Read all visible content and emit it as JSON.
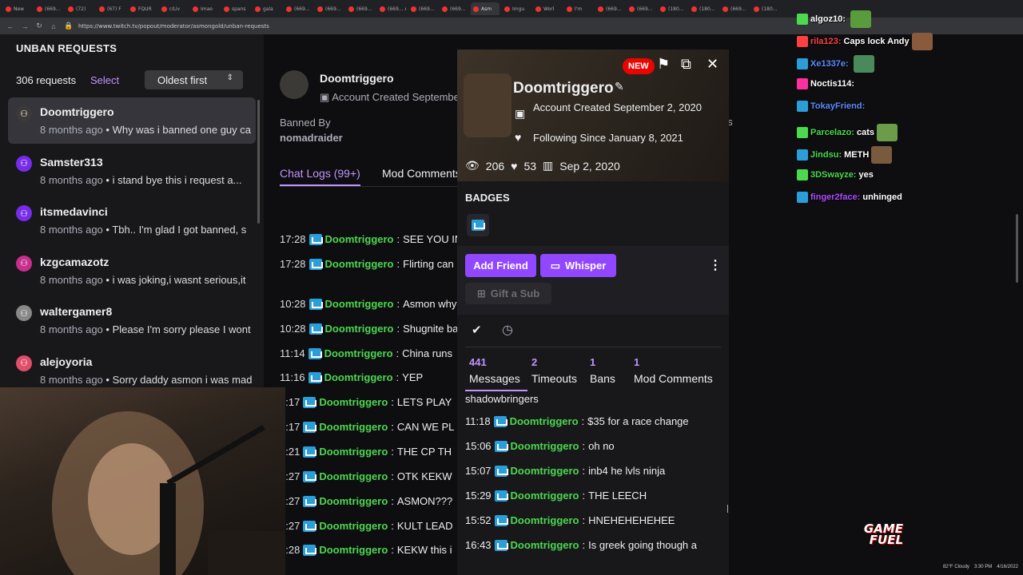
{
  "browser": {
    "tabs": [
      {
        "label": "New"
      },
      {
        "label": "(669..."
      },
      {
        "label": "(72)"
      },
      {
        "label": "(67) F"
      },
      {
        "label": "FQUR"
      },
      {
        "label": "r/Liv"
      },
      {
        "label": "Imao"
      },
      {
        "label": "spans"
      },
      {
        "label": "gala"
      },
      {
        "label": "(669..."
      },
      {
        "label": "(669..."
      },
      {
        "label": "(669..."
      },
      {
        "label": "(669... AUTOM"
      },
      {
        "label": "(669..."
      },
      {
        "label": "(669..."
      },
      {
        "label": "Asm",
        "active": true
      },
      {
        "label": "Imgu"
      },
      {
        "label": "Worl"
      },
      {
        "label": "I'm"
      },
      {
        "label": "(669..."
      },
      {
        "label": "(669..."
      },
      {
        "label": "(180..."
      },
      {
        "label": "(180..."
      },
      {
        "label": "(669..."
      },
      {
        "label": "(180..."
      }
    ],
    "url": "https://www.twitch.tv/popout/moderator/asmongold/unban-requests"
  },
  "unban": {
    "title": "UNBAN REQUESTS",
    "count_label": "306 requests",
    "select_label": "Select",
    "sort_value": "Oldest first",
    "requests": [
      {
        "name": "Doomtriggero",
        "time": "8 months ago",
        "msg": "• Why was i banned one guy ca",
        "selected": true
      },
      {
        "name": "Samster313",
        "time": "8 months ago",
        "msg": "• i stand bye this i request a..."
      },
      {
        "name": "itsmedavinci",
        "time": "8 months ago",
        "msg": "• Tbh.. I'm glad I got banned, s"
      },
      {
        "name": "kzgcamazotz",
        "time": "8 months ago",
        "msg": "• i was joking,i wasnt serious,it"
      },
      {
        "name": "waltergamer8",
        "time": "8 months ago",
        "msg": "• Please I'm sorry please I wont"
      },
      {
        "name": "alejoyoria",
        "time": "8 months ago",
        "msg": "• Sorry daddy asmon i was mad"
      }
    ]
  },
  "detail": {
    "name": "Doomtriggero",
    "account_created": "Account Created September",
    "banned_by_label": "Banned By",
    "banned_by": "nomadraider",
    "tab_chat": "Chat Logs (99+)",
    "tab_mod": "Mod Comments",
    "right_fragment": "ns",
    "logs": [
      {
        "time": "17:28",
        "user": "Doomtriggero",
        "msg": "SEE YOU IN"
      },
      {
        "time": "17:28",
        "user": "Doomtriggero",
        "msg": "Flirting can"
      },
      {
        "time": "10:28",
        "user": "Doomtriggero",
        "msg": "Asmon why"
      },
      {
        "time": "10:28",
        "user": "Doomtriggero",
        "msg": "Shugnite ba"
      },
      {
        "time": "11:14",
        "user": "Doomtriggero",
        "msg": "China runs"
      },
      {
        "time": "11:16",
        "user": "Doomtriggero",
        "msg": "YEP"
      },
      {
        "time": "1:17",
        "user": "Doomtriggero",
        "msg": "LETS PLAY"
      },
      {
        "time": "1:17",
        "user": "Doomtriggero",
        "msg": "CAN WE PL"
      },
      {
        "time": "1:21",
        "user": "Doomtriggero",
        "msg": "THE CP TH"
      },
      {
        "time": "1:27",
        "user": "Doomtriggero",
        "msg": "OTK KEKW"
      },
      {
        "time": "1:27",
        "user": "Doomtriggero",
        "msg": "ASMON???"
      },
      {
        "time": "1:27",
        "user": "Doomtriggero",
        "msg": "KULT LEAD"
      },
      {
        "time": "1:28",
        "user": "Doomtriggero",
        "msg": "KEKW this i"
      }
    ]
  },
  "card": {
    "new_badge": "NEW",
    "name": "Doomtriggero",
    "account_created": "Account Created September 2, 2020",
    "following_since": "Following Since January 8, 2021",
    "views": "206",
    "likes": "53",
    "cake_date": "Sep 2, 2020",
    "badges_header": "BADGES",
    "add_friend": "Add Friend",
    "whisper": "Whisper",
    "gift_sub": "Gift a Sub",
    "stats": [
      {
        "num": "441",
        "label": "Messages"
      },
      {
        "num": "2",
        "label": "Timeouts"
      },
      {
        "num": "1",
        "label": "Bans"
      },
      {
        "num": "1",
        "label": "Mod Comments"
      }
    ],
    "partial_line": "shadowbringers",
    "messages": [
      {
        "time": "11:18",
        "user": "Doomtriggero",
        "msg": "$35 for a race change"
      },
      {
        "time": "15:06",
        "user": "Doomtriggero",
        "msg": "oh no"
      },
      {
        "time": "15:07",
        "user": "Doomtriggero",
        "msg": "inb4 he lvls ninja"
      },
      {
        "time": "15:29",
        "user": "Doomtriggero",
        "msg": "THE LEECH"
      },
      {
        "time": "15:52",
        "user": "Doomtriggero",
        "msg": "HNEHEHEHEHEE"
      },
      {
        "time": "16:43",
        "user": "Doomtriggero",
        "msg": "Is greek going though a"
      }
    ]
  },
  "overlay_chat": [
    {
      "user": "algoz10:",
      "msg": "",
      "color": "#ffffff"
    },
    {
      "user": "rila123:",
      "msg": "Caps lock Andy",
      "color": "#ff4040"
    },
    {
      "user": "Xe1337e:",
      "msg": "",
      "color": "#5b8cff"
    },
    {
      "user": "Noctis114:",
      "msg": "",
      "color": "#ffffff"
    },
    {
      "user": "TokayFriend:",
      "msg": "",
      "color": "#5b8cff"
    },
    {
      "user": "Parcelazo:",
      "msg": "cats",
      "color": "#4cd84f"
    },
    {
      "user": "Jindsu:",
      "msg": "METH",
      "color": "#4cd84f"
    },
    {
      "user": "3DSwayze:",
      "msg": "yes",
      "color": "#4cd84f"
    },
    {
      "user": "finger2face:",
      "msg": "unhinged",
      "color": "#b04cff"
    }
  ],
  "sponsor": "GAME FUEL",
  "taskbar": {
    "weather": "82°F Cloudy",
    "time": "3:30 PM",
    "date": "4/16/2022"
  }
}
